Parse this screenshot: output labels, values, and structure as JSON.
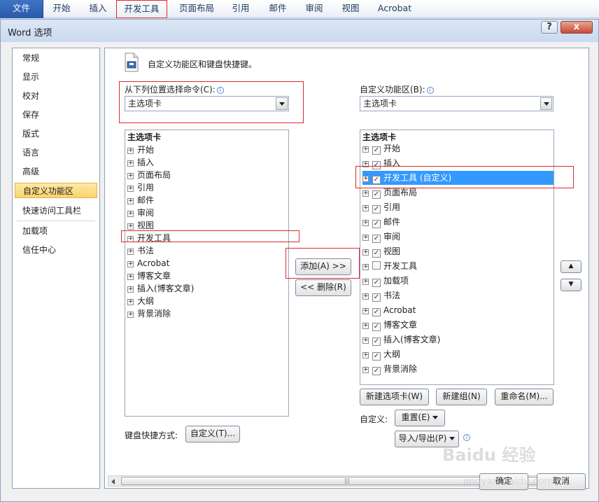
{
  "ribbon": {
    "tabs": [
      "文件",
      "开始",
      "插入",
      "开发工具",
      "页面布局",
      "引用",
      "邮件",
      "审阅",
      "视图",
      "Acrobat"
    ]
  },
  "dialog": {
    "title": "Word 选项",
    "title_buttons": [
      "?",
      "x"
    ]
  },
  "nav": {
    "items": [
      "常规",
      "显示",
      "校对",
      "保存",
      "版式",
      "语言",
      "高级",
      "自定义功能区",
      "快速访问工具栏",
      "加载项",
      "信任中心"
    ],
    "selected": "自定义功能区"
  },
  "main": {
    "heading": "自定义功能区和键盘快捷键。",
    "left_label": "从下列位置选择命令(C):",
    "left_combo": "主选项卡",
    "right_label": "自定义功能区(B):",
    "right_combo": "主选项卡",
    "left_list": {
      "header": "主选项卡",
      "items": [
        "开始",
        "插入",
        "页面布局",
        "引用",
        "邮件",
        "审阅",
        "视图",
        "开发工具",
        "书法",
        "Acrobat",
        "博客文章",
        "插入(博客文章)",
        "大纲",
        "背景消除"
      ]
    },
    "right_list": {
      "header": "主选项卡",
      "items": [
        {
          "label": "开始",
          "checked": true
        },
        {
          "label": "插入",
          "checked": true
        },
        {
          "label": "开发工具 (自定义)",
          "checked": true,
          "selected": true
        },
        {
          "label": "页面布局",
          "checked": true
        },
        {
          "label": "引用",
          "checked": true
        },
        {
          "label": "邮件",
          "checked": true
        },
        {
          "label": "审阅",
          "checked": true
        },
        {
          "label": "视图",
          "checked": true
        },
        {
          "label": "开发工具",
          "checked": false
        },
        {
          "label": "加载项",
          "checked": true
        },
        {
          "label": "书法",
          "checked": true
        },
        {
          "label": "Acrobat",
          "checked": true
        },
        {
          "label": "博客文章",
          "checked": true
        },
        {
          "label": "插入(博客文章)",
          "checked": true
        },
        {
          "label": "大纲",
          "checked": true
        },
        {
          "label": "背景消除",
          "checked": true
        }
      ]
    },
    "add_button": "添加(A) >>",
    "remove_button": "<< 删除(R)",
    "move_up": "▲",
    "move_down": "▼",
    "new_tab_button": "新建选项卡(W)",
    "new_group_button": "新建组(N)",
    "rename_button": "重命名(M)...",
    "customize_label": "自定义:",
    "reset_button": "重置(E)",
    "import_export_button": "导入/导出(P)",
    "keyboard_label": "键盘快捷方式:",
    "keyboard_button": "自定义(T)...",
    "scroll_grip": "|||"
  },
  "footer": {
    "ok_button": "确定",
    "cancel_button": "取消"
  },
  "watermark": {
    "logo": "Baidu 经验",
    "url": "jingyan.baidu.com"
  },
  "colors": {
    "highlight_red": "#e0282d",
    "selection_blue": "#3399ff",
    "nav_selected": "#fbd46b",
    "file_tab": "#2a5aa8"
  }
}
